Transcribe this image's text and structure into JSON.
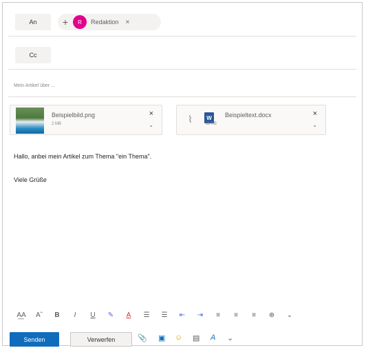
{
  "to": {
    "label": "An",
    "plus": "+",
    "recipient_initial": "R",
    "recipient_name": "Redaktion",
    "remove": "×"
  },
  "cc": {
    "label": "Cc"
  },
  "subject": {
    "placeholder": "Mein Artikel über ..."
  },
  "attachments": [
    {
      "name": "Beispielbild.png",
      "size": "2 MB",
      "remove": "×",
      "expand": "⌄"
    },
    {
      "name": "Beispieltext.docx",
      "size": "11 KB",
      "remove": "×",
      "expand": "⌄",
      "icon": "W"
    }
  ],
  "body": {
    "line1": "Hallo, anbei mein Artikel zum Thema \"ein Thema\".",
    "line2": "Viele Grüße"
  },
  "toolbar": {
    "font_size": "A͟A",
    "grow": "Aˆ",
    "bold": "B",
    "italic": "I",
    "underline": "U",
    "highlight": "✎",
    "font_color": "A",
    "bullets": "☰",
    "numbering": "☰",
    "outdent": "⇤",
    "indent": "⇥",
    "align_left": "≡",
    "align_center": "≡",
    "align_right": "≡",
    "link": "⊕",
    "more": "⌄"
  },
  "actions": {
    "send": "Senden",
    "discard": "Verwerfen",
    "attach": "📎",
    "image": "▣",
    "emoji": "☺",
    "schedule": "▤",
    "format": "A",
    "more": "⌄"
  }
}
